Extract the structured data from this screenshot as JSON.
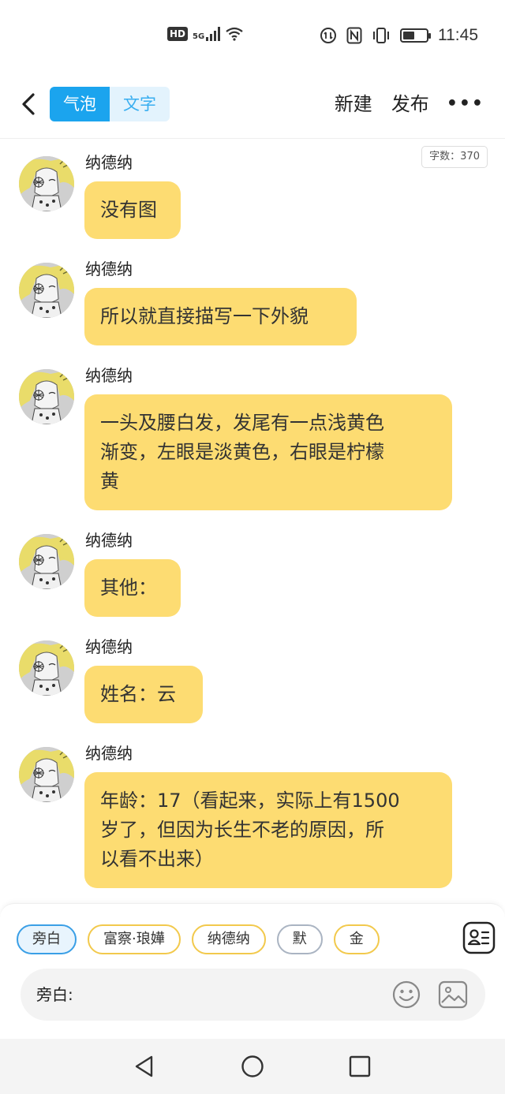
{
  "status_bar": {
    "hd": "HD",
    "network": "5G",
    "time": "11:45",
    "battery_level": 0.5,
    "icons": [
      "hd-icon",
      "signal-icon",
      "wifi-icon",
      "data-saver-icon",
      "nfc-icon",
      "vibrate-icon",
      "battery-icon"
    ]
  },
  "toolbar": {
    "tabs": [
      {
        "label": "气泡",
        "active": true
      },
      {
        "label": "文字",
        "active": false
      }
    ],
    "new_label": "新建",
    "publish_label": "发布",
    "more_label": "•••"
  },
  "word_count": "字数：370",
  "messages": [
    {
      "sender": "纳德纳",
      "lines": [
        "没有图"
      ]
    },
    {
      "sender": "纳德纳",
      "lines": [
        "所以就直接描写一下外貌"
      ]
    },
    {
      "sender": "纳德纳",
      "lines": [
        "一头及腰白发，发尾有一点浅黄色",
        "渐变，左眼是淡黄色，右眼是柠檬",
        "黄"
      ]
    },
    {
      "sender": "纳德纳",
      "lines": [
        "其他："
      ]
    },
    {
      "sender": "纳德纳",
      "lines": [
        "姓名：云"
      ]
    },
    {
      "sender": "纳德纳",
      "lines": [
        "年龄：17（看起来，实际上有1500",
        "岁了，但因为长生不老的原因，所",
        "以看不出来）"
      ]
    }
  ],
  "roles": [
    {
      "label": "旁白",
      "style": "active"
    },
    {
      "label": "富察·琅嬅",
      "style": "yellow"
    },
    {
      "label": "纳德纳",
      "style": "yellow"
    },
    {
      "label": "默",
      "style": "gray"
    },
    {
      "label": "金",
      "style": "yellow"
    }
  ],
  "input": {
    "label": "旁白:"
  },
  "colors": {
    "accent": "#1ba4ee",
    "bubble": "#fddc72",
    "chip_border": "#f2c94c"
  }
}
